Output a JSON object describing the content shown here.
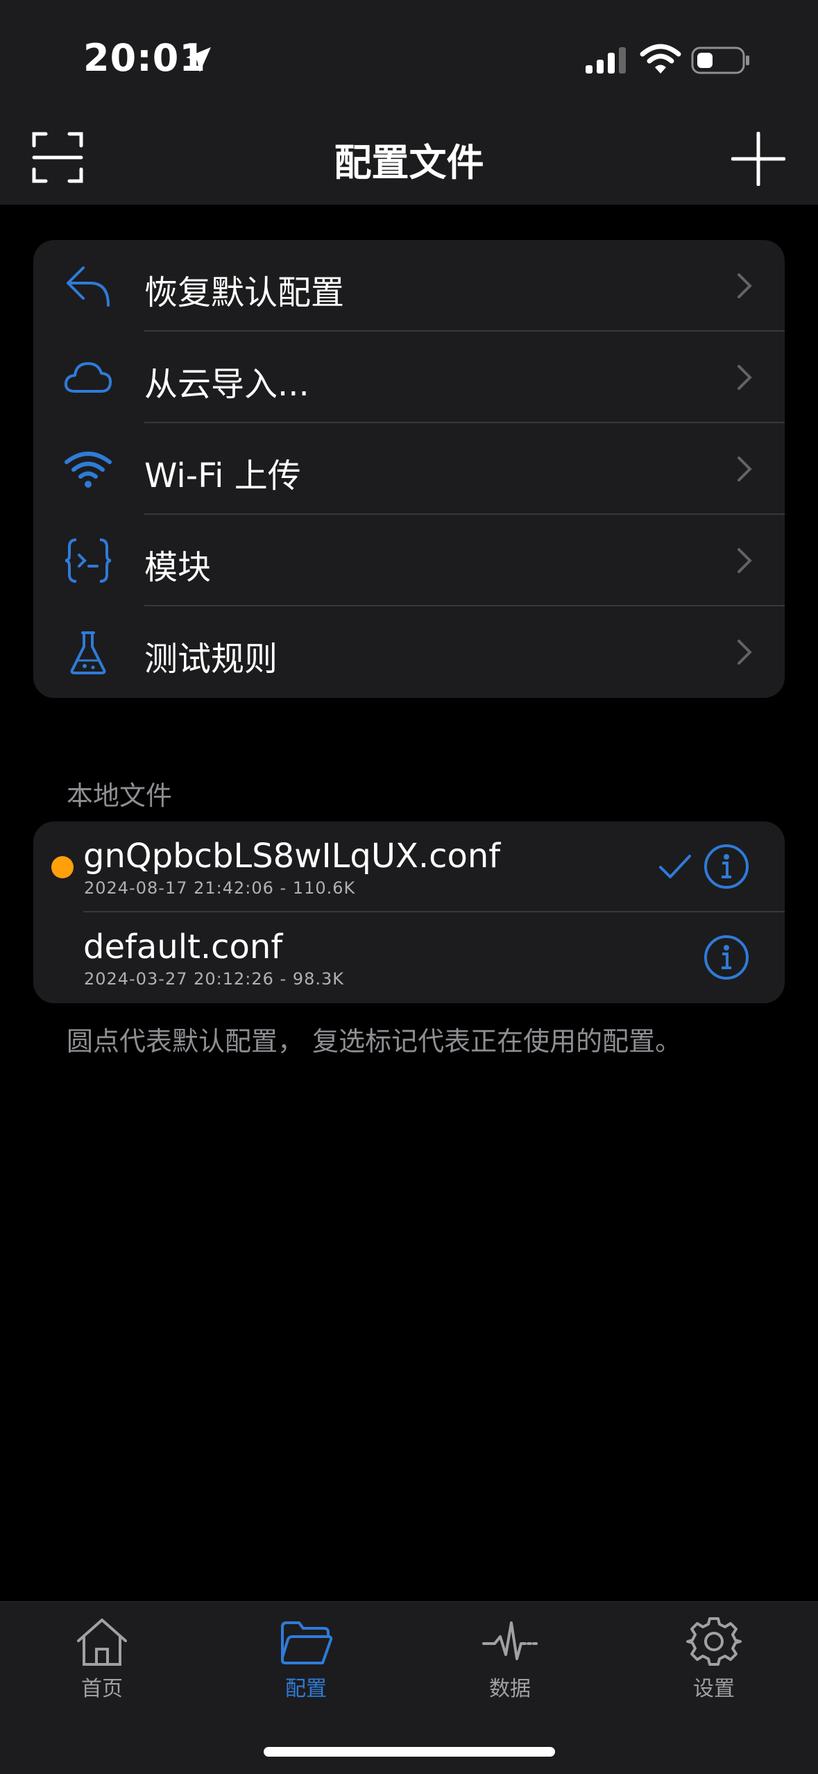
{
  "status": {
    "time": "20:01"
  },
  "nav": {
    "title": "配置文件"
  },
  "menu": [
    {
      "label": "恢复默认配置",
      "icon": "undo-arrow-icon"
    },
    {
      "label": "从云导入...",
      "icon": "cloud-icon"
    },
    {
      "label": "Wi-Fi 上传",
      "icon": "wifi-icon"
    },
    {
      "label": "模块",
      "icon": "module-braces-icon"
    },
    {
      "label": "测试规则",
      "icon": "flask-icon"
    }
  ],
  "local": {
    "header": "本地文件",
    "files": [
      {
        "name": "gnQpbcbLS8wILqUX.conf",
        "meta": "2024-08-17 21:42:06 - 110.6K",
        "is_default": true,
        "in_use": true
      },
      {
        "name": "default.conf",
        "meta": "2024-03-27 20:12:26 - 98.3K",
        "is_default": false,
        "in_use": false
      }
    ],
    "footnote": "圆点代表默认配置， 复选标记代表正在使用的配置。"
  },
  "tabs": [
    {
      "label": "首页",
      "icon": "home-icon",
      "active": false
    },
    {
      "label": "配置",
      "icon": "folder-icon",
      "active": true
    },
    {
      "label": "数据",
      "icon": "activity-icon",
      "active": false
    },
    {
      "label": "设置",
      "icon": "gear-icon",
      "active": false
    }
  ],
  "colors": {
    "accent": "#2f7bd8",
    "default_dot": "#ff9f0a",
    "background": "#000000",
    "card": "#1c1c1e"
  }
}
